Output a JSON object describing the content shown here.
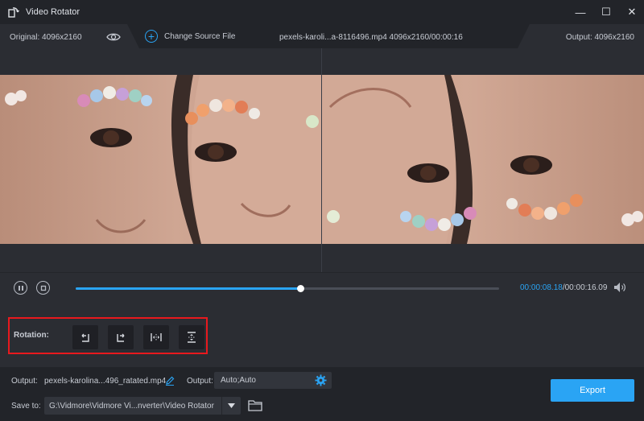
{
  "app": {
    "title": "Video Rotator"
  },
  "window_controls": {
    "minimize": "—",
    "maximize": "☐",
    "close": "✕"
  },
  "infobar": {
    "original": "Original: 4096x2160",
    "change_source": "Change Source File",
    "filename": "pexels-karoli...a-8116496.mp4   4096x2160/00:00:16",
    "output": "Output: 4096x2160"
  },
  "playback": {
    "current_time": "00:00:08.18",
    "total_time": "/00:00:16.09",
    "progress": 0.53
  },
  "rotation": {
    "label": "Rotation:",
    "buttons": [
      "rotate-left",
      "rotate-right",
      "flip-horizontal",
      "flip-vertical"
    ]
  },
  "output": {
    "label": "Output:",
    "filename": "pexels-karolina...496_ratated.mp4",
    "settings_label": "Output:",
    "settings_value": "Auto;Auto"
  },
  "save": {
    "label": "Save to:",
    "path": "G:\\Vidmore\\Vidmore Vi...nverter\\Video Rotator"
  },
  "export": {
    "label": "Export"
  },
  "colors": {
    "accent": "#2aa4f4",
    "highlight": "#e8191e",
    "background": "#2b2d33"
  }
}
